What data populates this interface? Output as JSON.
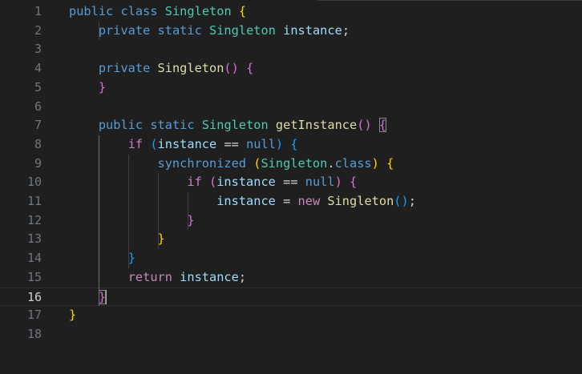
{
  "editor": {
    "language": "java",
    "current_line": 16,
    "lines": [
      {
        "num": "1",
        "tokens": [
          [
            "kw",
            "public"
          ],
          [
            "plain",
            " "
          ],
          [
            "kw",
            "class"
          ],
          [
            "plain",
            " "
          ],
          [
            "type",
            "Singleton"
          ],
          [
            "plain",
            " "
          ],
          [
            "b1",
            "{"
          ]
        ]
      },
      {
        "num": "2",
        "tokens": [
          [
            "plain",
            "    "
          ],
          [
            "kw",
            "private"
          ],
          [
            "plain",
            " "
          ],
          [
            "kw",
            "static"
          ],
          [
            "plain",
            " "
          ],
          [
            "type",
            "Singleton"
          ],
          [
            "plain",
            " "
          ],
          [
            "var",
            "instance"
          ],
          [
            "plain",
            ";"
          ]
        ]
      },
      {
        "num": "3",
        "tokens": []
      },
      {
        "num": "4",
        "tokens": [
          [
            "plain",
            "    "
          ],
          [
            "kw",
            "private"
          ],
          [
            "plain",
            " "
          ],
          [
            "fn",
            "Singleton"
          ],
          [
            "b2",
            "()"
          ],
          [
            "plain",
            " "
          ],
          [
            "b2",
            "{"
          ]
        ]
      },
      {
        "num": "5",
        "tokens": [
          [
            "plain",
            "    "
          ],
          [
            "b2",
            "}"
          ]
        ]
      },
      {
        "num": "6",
        "tokens": []
      },
      {
        "num": "7",
        "tokens": [
          [
            "plain",
            "    "
          ],
          [
            "kw",
            "public"
          ],
          [
            "plain",
            " "
          ],
          [
            "kw",
            "static"
          ],
          [
            "plain",
            " "
          ],
          [
            "type",
            "Singleton"
          ],
          [
            "plain",
            " "
          ],
          [
            "fn",
            "getInstance"
          ],
          [
            "b2",
            "()"
          ],
          [
            "plain",
            " "
          ],
          [
            "b2 bm",
            "{"
          ]
        ]
      },
      {
        "num": "8",
        "tokens": [
          [
            "plain",
            "        "
          ],
          [
            "kw2",
            "if"
          ],
          [
            "plain",
            " "
          ],
          [
            "b3",
            "("
          ],
          [
            "var",
            "instance"
          ],
          [
            "plain",
            " == "
          ],
          [
            "kw",
            "null"
          ],
          [
            "b3",
            ")"
          ],
          [
            "plain",
            " "
          ],
          [
            "b3",
            "{"
          ]
        ]
      },
      {
        "num": "9",
        "tokens": [
          [
            "plain",
            "            "
          ],
          [
            "kw",
            "synchronized"
          ],
          [
            "plain",
            " "
          ],
          [
            "b1",
            "("
          ],
          [
            "type",
            "Singleton"
          ],
          [
            "plain",
            "."
          ],
          [
            "kw",
            "class"
          ],
          [
            "b1",
            ")"
          ],
          [
            "plain",
            " "
          ],
          [
            "b1",
            "{"
          ]
        ]
      },
      {
        "num": "10",
        "tokens": [
          [
            "plain",
            "                "
          ],
          [
            "kw2",
            "if"
          ],
          [
            "plain",
            " "
          ],
          [
            "b2",
            "("
          ],
          [
            "var",
            "instance"
          ],
          [
            "plain",
            " == "
          ],
          [
            "kw",
            "null"
          ],
          [
            "b2",
            ")"
          ],
          [
            "plain",
            " "
          ],
          [
            "b2",
            "{"
          ]
        ]
      },
      {
        "num": "11",
        "tokens": [
          [
            "plain",
            "                    "
          ],
          [
            "var",
            "instance"
          ],
          [
            "plain",
            " = "
          ],
          [
            "kw2",
            "new"
          ],
          [
            "plain",
            " "
          ],
          [
            "fn",
            "Singleton"
          ],
          [
            "b3",
            "()"
          ],
          [
            "plain",
            ";"
          ]
        ]
      },
      {
        "num": "12",
        "tokens": [
          [
            "plain",
            "                "
          ],
          [
            "b2",
            "}"
          ]
        ]
      },
      {
        "num": "13",
        "tokens": [
          [
            "plain",
            "            "
          ],
          [
            "b1",
            "}"
          ]
        ]
      },
      {
        "num": "14",
        "tokens": [
          [
            "plain",
            "        "
          ],
          [
            "b3",
            "}"
          ]
        ]
      },
      {
        "num": "15",
        "tokens": [
          [
            "plain",
            "        "
          ],
          [
            "kw2",
            "return"
          ],
          [
            "plain",
            " "
          ],
          [
            "var",
            "instance"
          ],
          [
            "plain",
            ";"
          ]
        ]
      },
      {
        "num": "16",
        "tokens": [
          [
            "plain",
            "    "
          ],
          [
            "b2 bm",
            "}"
          ],
          [
            "cursor",
            ""
          ]
        ]
      },
      {
        "num": "17",
        "tokens": [
          [
            "b1",
            "}"
          ]
        ]
      },
      {
        "num": "18",
        "tokens": []
      }
    ]
  }
}
